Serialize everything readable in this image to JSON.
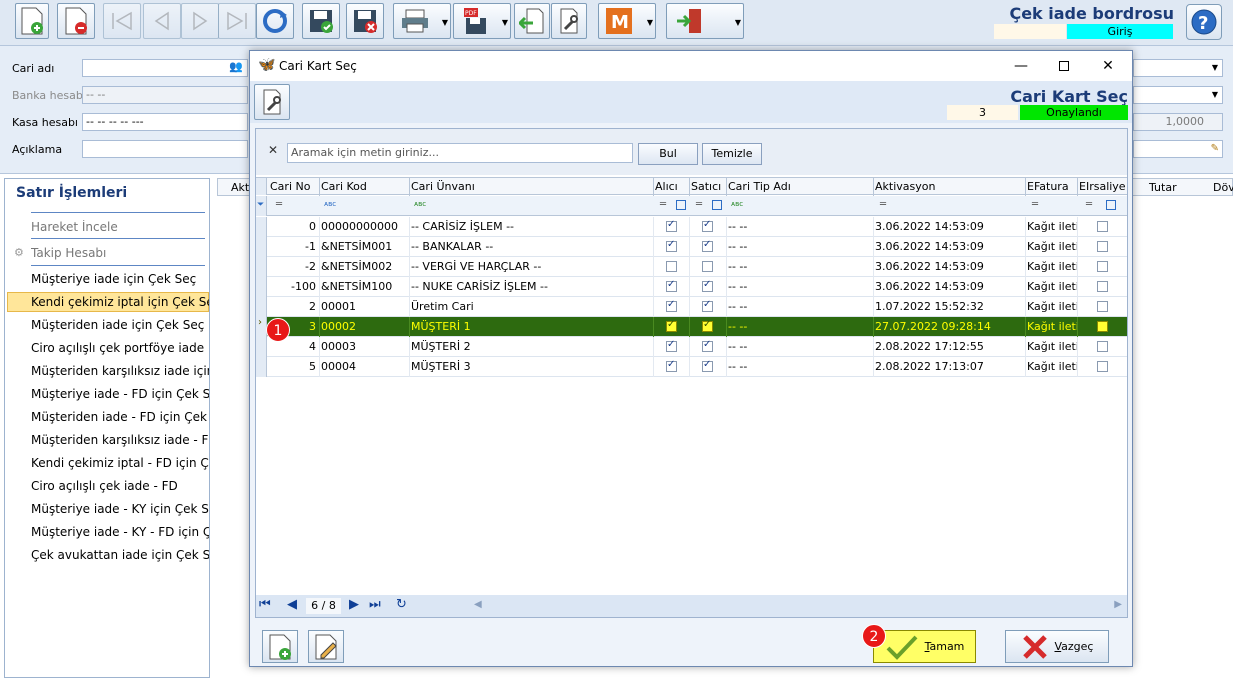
{
  "toolbar": {
    "form_title": "Çek iade bordrosu",
    "mode": "Giriş",
    "buttons": [
      "new-document",
      "delete-document",
      "first",
      "previous",
      "next",
      "last",
      "refresh",
      "save-approve",
      "save-cancel",
      "print",
      "pdf-export",
      "import",
      "settings",
      "m-module",
      "exit"
    ]
  },
  "form": {
    "cari_adi_label": "Cari adı",
    "cari_adi_value": "",
    "banka_hesabi_label": "Banka hesabı",
    "banka_hesabi_value": "-- --",
    "kasa_hesabi_label": "Kasa hesabı",
    "kasa_hesabi_value": "-- -- -- -- ---",
    "aciklama_label": "Açıklama",
    "aciklama_value": "",
    "rate_value": "1,0000"
  },
  "left_panel": {
    "title": "Satır İşlemleri",
    "items": [
      {
        "label": "Hareket İncele",
        "disabled": true
      },
      {
        "label": "Takip Hesabı",
        "disabled": true
      },
      {
        "label": "Müşteriye iade için Çek Seç"
      },
      {
        "label": "Kendi çekimiz iptal için Çek Seç",
        "selected": true
      },
      {
        "label": "Müşteriden iade için Çek Seç"
      },
      {
        "label": "Ciro açılışlı çek portföye iade"
      },
      {
        "label": "Müşteriden karşılıksız iade için ..."
      },
      {
        "label": "Müşteriye iade - FD için Çek Seç"
      },
      {
        "label": "Müşteriden iade - FD için Çek Seç"
      },
      {
        "label": "Müşteriden karşılıksız iade - FD i..."
      },
      {
        "label": "Kendi çekimiz iptal - FD için Çe..."
      },
      {
        "label": "Ciro açılışlı çek iade - FD"
      },
      {
        "label": "Müşteriye iade - KY için Çek Seç"
      },
      {
        "label": "Müşteriye iade - KY - FD için Çe..."
      },
      {
        "label": "Çek avukattan iade için Çek Seç"
      }
    ]
  },
  "background_grid": {
    "col_aktif": "Akti",
    "col_tutar": "Tutar",
    "col_doviz": "Döv"
  },
  "dialog": {
    "title": "Cari Kart Seç",
    "heading": "Cari Kart Seç",
    "count": "3",
    "status": "Onaylandı",
    "search_placeholder": "Aramak için metin giriniz...",
    "search_button": "Bul",
    "clear_button": "Temizle",
    "columns": [
      "Cari No",
      "Cari Kod",
      "Cari Ünvanı",
      "Alıcı",
      "Satıcı",
      "Cari Tip Adı",
      "Aktivasyon",
      "EFatura",
      "EIrsaliye"
    ],
    "rows": [
      {
        "no": "0",
        "kod": "00000000000",
        "unvan": "-- CARİSİZ İŞLEM --",
        "alici": true,
        "satici": true,
        "tip": "-- --",
        "aktivasyon": "3.06.2022 14:53:09",
        "efatura": "Kağıt iletin",
        "eirsaliye": false
      },
      {
        "no": "-1",
        "kod": "&NETSİM001",
        "unvan": "-- BANKALAR --",
        "alici": true,
        "satici": true,
        "tip": "-- --",
        "aktivasyon": "3.06.2022 14:53:09",
        "efatura": "Kağıt iletin",
        "eirsaliye": false
      },
      {
        "no": "-2",
        "kod": "&NETSİM002",
        "unvan": "-- VERGİ VE HARÇLAR --",
        "alici": false,
        "satici": false,
        "tip": "-- --",
        "aktivasyon": "3.06.2022 14:53:09",
        "efatura": "Kağıt iletin",
        "eirsaliye": false
      },
      {
        "no": "-100",
        "kod": "&NETSİM100",
        "unvan": "-- NUKE CARİSİZ İŞLEM --",
        "alici": true,
        "satici": true,
        "tip": "-- --",
        "aktivasyon": "3.06.2022 14:53:09",
        "efatura": "Kağıt iletin",
        "eirsaliye": false
      },
      {
        "no": "2",
        "kod": "00001",
        "unvan": "Üretim Cari",
        "alici": true,
        "satici": true,
        "tip": "-- --",
        "aktivasyon": "1.07.2022 15:52:32",
        "efatura": "Kağıt iletin",
        "eirsaliye": false
      },
      {
        "no": "3",
        "kod": "00002",
        "unvan": "MÜŞTERİ 1",
        "alici": true,
        "satici": true,
        "tip": "-- --",
        "aktivasyon": "27.07.2022 09:28:14",
        "efatura": "Kağıt iletin",
        "eirsaliye": false,
        "selected": true
      },
      {
        "no": "4",
        "kod": "00003",
        "unvan": "MÜŞTERİ 2",
        "alici": true,
        "satici": true,
        "tip": "-- --",
        "aktivasyon": "2.08.2022 17:12:55",
        "efatura": "Kağıt iletin",
        "eirsaliye": false
      },
      {
        "no": "5",
        "kod": "00004",
        "unvan": "MÜŞTERİ 3",
        "alici": true,
        "satici": true,
        "tip": "-- --",
        "aktivasyon": "2.08.2022 17:13:07",
        "efatura": "Kağıt iletin",
        "eirsaliye": false
      }
    ],
    "nav_position": "6 / 8",
    "ok_label_accel": "T",
    "ok_label_rest": "amam",
    "cancel_label_accel": "V",
    "cancel_label_rest": "azgeç",
    "markers": [
      "1",
      "2"
    ]
  },
  "colors": {
    "selected_row_bg": "#2d6a0f",
    "selected_row_text": "#ffff00",
    "status_green": "#00e600",
    "mode_cyan": "#00ffff",
    "ok_button": "#ffff66",
    "title_blue": "#1c3c78",
    "marker_red": "#e81818"
  }
}
